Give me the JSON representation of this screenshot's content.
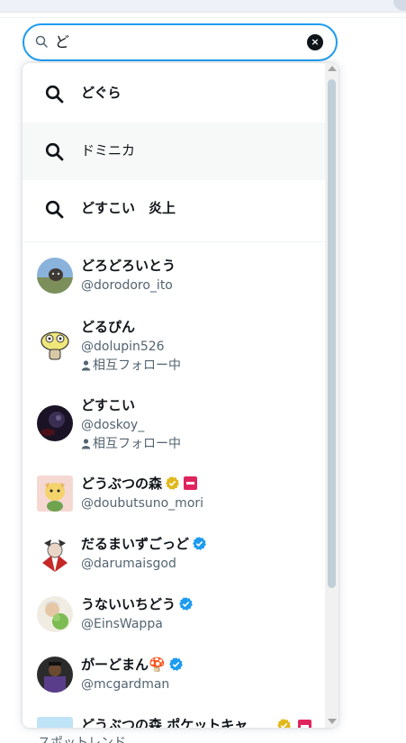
{
  "search": {
    "value": "ど",
    "clear_label": "×"
  },
  "suggestions": [
    {
      "text": "どぐら",
      "bold": true
    },
    {
      "text": "ドミニカ",
      "bold": false
    },
    {
      "text": "どすこい　炎上",
      "bold": true
    }
  ],
  "users": [
    {
      "name": "どろどろいとう",
      "handle": "@dorodoro_ito"
    },
    {
      "name": "どるぴん",
      "handle": "@dolupin526",
      "mutual": "相互フォロー中"
    },
    {
      "name": "どすこい",
      "handle": "@doskoy_",
      "mutual": "相互フォロー中"
    },
    {
      "name": "どうぶつの森",
      "handle": "@doubutsuno_mori",
      "badge": "gold"
    },
    {
      "name": "だるまいずごっど",
      "handle": "@darumaisgod",
      "badge": "blue"
    },
    {
      "name": "うないいちどう",
      "handle": "@EinsWappa",
      "badge": "blue"
    },
    {
      "name": "がーどまん🍄",
      "handle": "@mcgardman",
      "badge": "blue"
    },
    {
      "name": "どうぶつの森 ポケットキャ"
    }
  ],
  "footer": {
    "partial_text": "スポットレンド"
  },
  "colors": {
    "accent": "#1d9bf0",
    "gold_badge": "#e2b719",
    "affiliate_red": "#e0245e",
    "secondary_text": "#536471"
  }
}
